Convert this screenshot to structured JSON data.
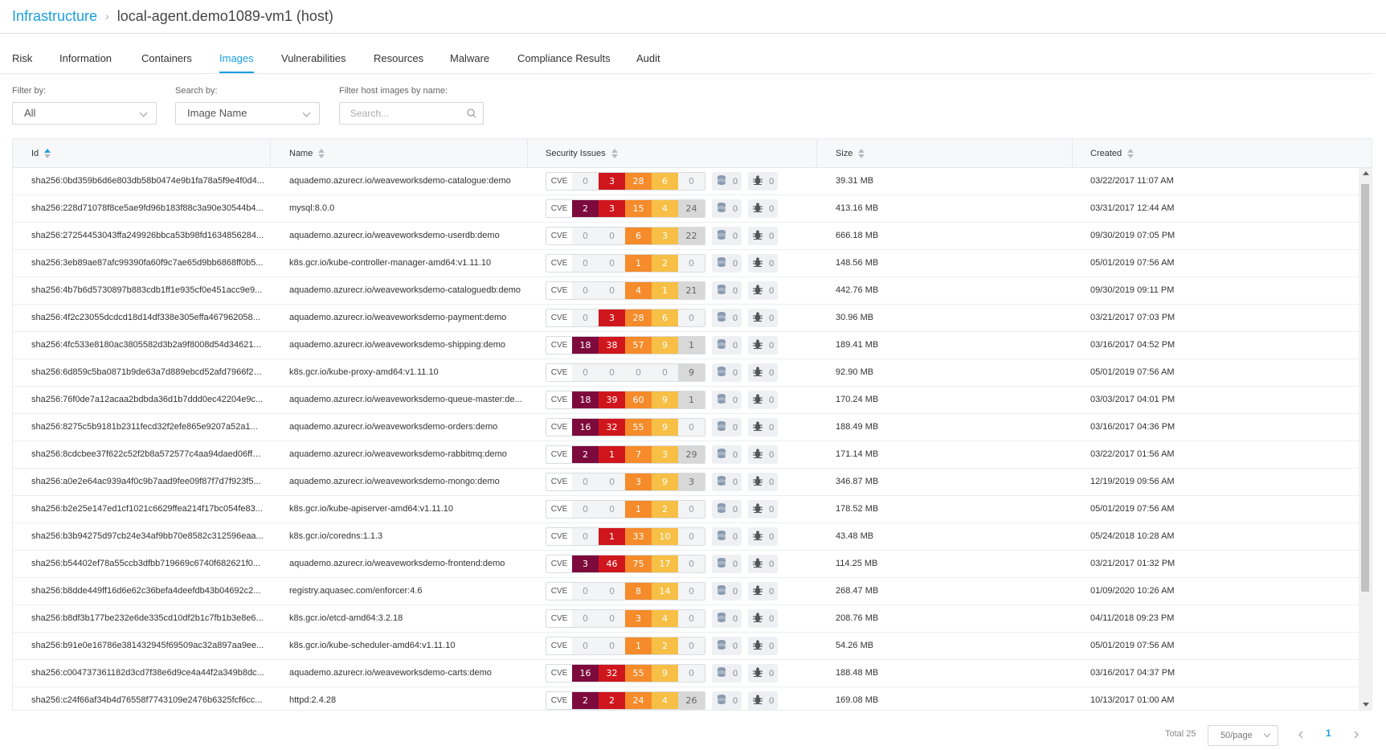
{
  "breadcrumb": {
    "root": "Infrastructure",
    "current": "local-agent.demo1089-vm1 (host)"
  },
  "tabs": [
    "Risk",
    "Information",
    "Containers",
    "Images",
    "Vulnerabilities",
    "Resources",
    "Malware",
    "Compliance Results",
    "Audit"
  ],
  "active_tab": "Images",
  "filters": {
    "filter_by": {
      "label": "Filter by:",
      "value": "All"
    },
    "search_by": {
      "label": "Search by:",
      "value": "Image Name"
    },
    "name_filter": {
      "label": "Filter host images by name:",
      "placeholder": "Search..."
    }
  },
  "table": {
    "columns": {
      "id": "Id",
      "name": "Name",
      "security": "Security Issues",
      "size": "Size",
      "created": "Created"
    },
    "cve_label": "CVE",
    "rows": [
      {
        "id": "sha256:0bd359b6d6e803db58b0474e9b1fa78a5f9e4f0d4...",
        "name": "aquademo.azurecr.io/weaveworksdemo-catalogue:demo",
        "sev": [
          0,
          3,
          28,
          6,
          0
        ],
        "malware": 0,
        "sensitive": 0,
        "size": "39.31 MB",
        "created": "03/22/2017 11:07 AM"
      },
      {
        "id": "sha256:228d71078f8ce5ae9fd96b183f88c3a90e30544b4...",
        "name": "mysql:8.0.0",
        "sev": [
          2,
          3,
          15,
          4,
          24
        ],
        "malware": 0,
        "sensitive": 0,
        "size": "413.16 MB",
        "created": "03/31/2017 12:44 AM"
      },
      {
        "id": "sha256:27254453043ffa249926bbca53b98fd1634856284...",
        "name": "aquademo.azurecr.io/weaveworksdemo-userdb:demo",
        "sev": [
          0,
          0,
          6,
          3,
          22
        ],
        "malware": 0,
        "sensitive": 0,
        "size": "666.18 MB",
        "created": "09/30/2019 07:05 PM"
      },
      {
        "id": "sha256:3eb89ae87afc99390fa60f9c7ae65d9bb6868ff0b5...",
        "name": "k8s.gcr.io/kube-controller-manager-amd64:v1.11.10",
        "sev": [
          0,
          0,
          1,
          2,
          0
        ],
        "malware": 0,
        "sensitive": 0,
        "size": "148.56 MB",
        "created": "05/01/2019 07:56 AM"
      },
      {
        "id": "sha256:4b7b6d5730897b883cdb1ff1e935cf0e451acc9e9...",
        "name": "aquademo.azurecr.io/weaveworksdemo-cataloguedb:demo",
        "sev": [
          0,
          0,
          4,
          1,
          21
        ],
        "malware": 0,
        "sensitive": 0,
        "size": "442.76 MB",
        "created": "09/30/2019 09:11 PM"
      },
      {
        "id": "sha256:4f2c23055dcdcd18d14df338e305effa467962058...",
        "name": "aquademo.azurecr.io/weaveworksdemo-payment:demo",
        "sev": [
          0,
          3,
          28,
          6,
          0
        ],
        "malware": 0,
        "sensitive": 0,
        "size": "30.96 MB",
        "created": "03/21/2017 07:03 PM"
      },
      {
        "id": "sha256:4fc533e8180ac3805582d3b2a9f8008d54d346211...",
        "name": "aquademo.azurecr.io/weaveworksdemo-shipping:demo",
        "sev": [
          18,
          38,
          57,
          9,
          1
        ],
        "malware": 0,
        "sensitive": 0,
        "size": "189.41 MB",
        "created": "03/16/2017 04:52 PM"
      },
      {
        "id": "sha256:6d859c5ba0871b9de63a7d889ebcd52afd7966f29...",
        "name": "k8s.gcr.io/kube-proxy-amd64:v1.11.10",
        "sev": [
          0,
          0,
          0,
          0,
          9
        ],
        "malware": 0,
        "sensitive": 0,
        "size": "92.90 MB",
        "created": "05/01/2019 07:56 AM"
      },
      {
        "id": "sha256:76f0de7a12acaa2bdbda36d1b7ddd0ec42204e9c...",
        "name": "aquademo.azurecr.io/weaveworksdemo-queue-master:de...",
        "sev": [
          18,
          39,
          60,
          9,
          1
        ],
        "malware": 0,
        "sensitive": 0,
        "size": "170.24 MB",
        "created": "03/03/2017 04:01 PM"
      },
      {
        "id": "sha256:8275c5b9181b2311fecd32f2efe865e9207a52a1...",
        "name": "aquademo.azurecr.io/weaveworksdemo-orders:demo",
        "sev": [
          16,
          32,
          55,
          9,
          0
        ],
        "malware": 0,
        "sensitive": 0,
        "size": "188.49 MB",
        "created": "03/16/2017 04:36 PM"
      },
      {
        "id": "sha256:8cdcbee37f622c52f2b8a572577c4aa94daed06ffe...",
        "name": "aquademo.azurecr.io/weaveworksdemo-rabbitmq:demo",
        "sev": [
          2,
          1,
          7,
          3,
          29
        ],
        "malware": 0,
        "sensitive": 0,
        "size": "171.14 MB",
        "created": "03/22/2017 01:56 AM"
      },
      {
        "id": "sha256:a0e2e64ac939a4f0c9b7aad9fee09f87f7d7f923f5...",
        "name": "aquademo.azurecr.io/weaveworksdemo-mongo:demo",
        "sev": [
          0,
          0,
          3,
          9,
          3
        ],
        "malware": 0,
        "sensitive": 0,
        "size": "346.87 MB",
        "created": "12/19/2019 09:56 AM"
      },
      {
        "id": "sha256:b2e25e147ed1cf1021c6629ffea214f17bc054fe83...",
        "name": "k8s.gcr.io/kube-apiserver-amd64:v1.11.10",
        "sev": [
          0,
          0,
          1,
          2,
          0
        ],
        "malware": 0,
        "sensitive": 0,
        "size": "178.52 MB",
        "created": "05/01/2019 07:56 AM"
      },
      {
        "id": "sha256:b3b94275d97cb24e34af9bb70e8582c312596eaa...",
        "name": "k8s.gcr.io/coredns:1.1.3",
        "sev": [
          0,
          1,
          33,
          10,
          0
        ],
        "malware": 0,
        "sensitive": 0,
        "size": "43.48 MB",
        "created": "05/24/2018 10:28 AM"
      },
      {
        "id": "sha256:b54402ef78a55ccb3dfbb719669c6740f682621f0...",
        "name": "aquademo.azurecr.io/weaveworksdemo-frontend:demo",
        "sev": [
          3,
          46,
          75,
          17,
          0
        ],
        "malware": 0,
        "sensitive": 0,
        "size": "114.25 MB",
        "created": "03/21/2017 01:32 PM"
      },
      {
        "id": "sha256:b8dde449ff16d6e62c36befa4deefdb43b04692c2...",
        "name": "registry.aquasec.com/enforcer:4.6",
        "sev": [
          0,
          0,
          8,
          14,
          0
        ],
        "malware": 0,
        "sensitive": 0,
        "size": "268.47 MB",
        "created": "01/09/2020 10:26 AM"
      },
      {
        "id": "sha256:b8df3b177be232e6de335cd10df2b1c7fb1b3e8e6...",
        "name": "k8s.gcr.io/etcd-amd64:3.2.18",
        "sev": [
          0,
          0,
          3,
          4,
          0
        ],
        "malware": 0,
        "sensitive": 0,
        "size": "208.76 MB",
        "created": "04/11/2018 09:23 PM"
      },
      {
        "id": "sha256:b91e0e16786e381432945f69509ac32a897aa9ee...",
        "name": "k8s.gcr.io/kube-scheduler-amd64:v1.11.10",
        "sev": [
          0,
          0,
          1,
          2,
          0
        ],
        "malware": 0,
        "sensitive": 0,
        "size": "54.26 MB",
        "created": "05/01/2019 07:56 AM"
      },
      {
        "id": "sha256:c004737361182d3cd7f38e6d9ce4a44f2a349b8dc...",
        "name": "aquademo.azurecr.io/weaveworksdemo-carts:demo",
        "sev": [
          16,
          32,
          55,
          9,
          0
        ],
        "malware": 0,
        "sensitive": 0,
        "size": "188.48 MB",
        "created": "03/16/2017 04:37 PM"
      },
      {
        "id": "sha256:c24f66af34b4d76558f7743109e2476b6325fcf6cc...",
        "name": "httpd:2.4.28",
        "sev": [
          2,
          2,
          24,
          4,
          26
        ],
        "malware": 0,
        "sensitive": 0,
        "size": "169.08 MB",
        "created": "10/13/2017 01:00 AM"
      }
    ]
  },
  "severity_colors": {
    "critical": "#7d0a3c",
    "high": "#d0161d",
    "medium": "#f58b2a",
    "low": "#f7bf45",
    "negligible": "#d8d8d8",
    "zero_bg": "#f3f4f6"
  },
  "pagination": {
    "total": "Total 25",
    "page_size": "50/page",
    "current_page": "1"
  }
}
